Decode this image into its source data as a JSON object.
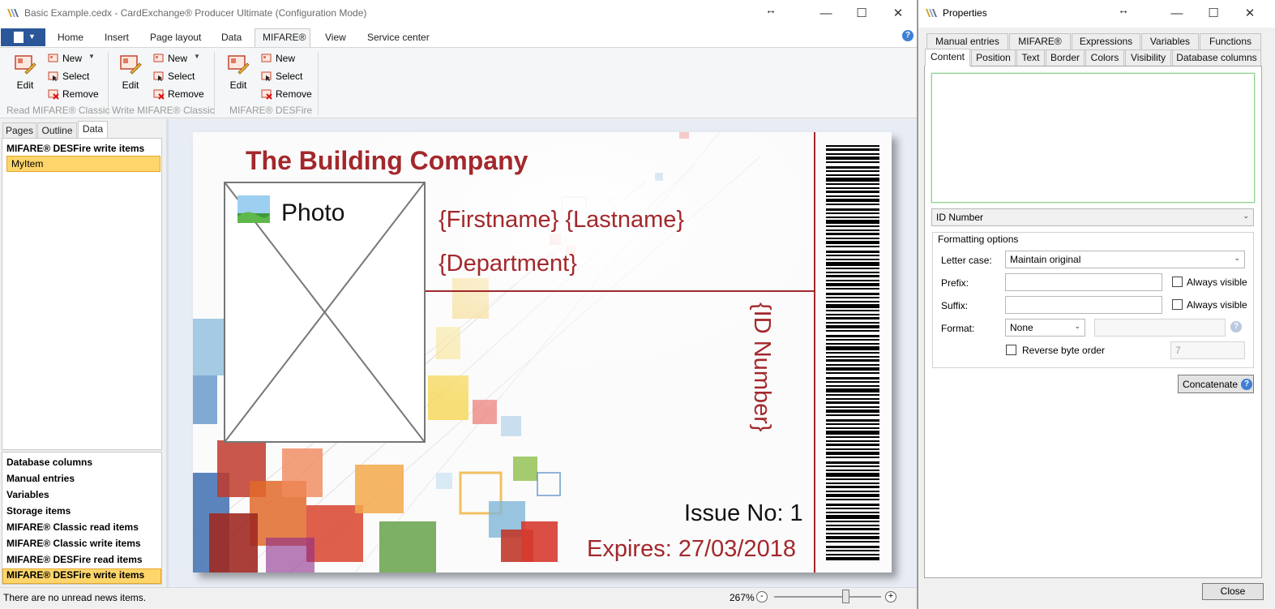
{
  "main_window": {
    "title": "Basic Example.cedx - CardExchange® Producer Ultimate (Configuration Mode)",
    "controls": {
      "minimize": "—",
      "maximize": "☐",
      "close": "✕",
      "resize": "↔"
    }
  },
  "ribbon": {
    "tabs": [
      "Home",
      "Insert",
      "Page layout",
      "Data",
      "MIFARE®",
      "View",
      "Service center"
    ],
    "active_tab": "MIFARE®",
    "help": "?",
    "groups": [
      {
        "label": "Read MIFARE® Classic",
        "edit": "Edit",
        "new": "New",
        "select": "Select",
        "remove": "Remove"
      },
      {
        "label": "Write MIFARE® Classic",
        "edit": "Edit",
        "new": "New",
        "select": "Select",
        "remove": "Remove"
      },
      {
        "label": "MIFARE® DESFire",
        "edit": "Edit",
        "new": "New",
        "select": "Select",
        "remove": "Remove"
      }
    ]
  },
  "left_panel": {
    "tabs": [
      "Pages",
      "Outline",
      "Data"
    ],
    "active_tab": "Data",
    "section_title": "MIFARE® DESFire write items",
    "selected_item": "MyItem",
    "categories": [
      "Database columns",
      "Manual entries",
      "Variables",
      "Storage items",
      "MIFARE® Classic read items",
      "MIFARE® Classic write items",
      "MIFARE® DESFire read items",
      "MIFARE® DESFire write items"
    ],
    "selected_category": "MIFARE® DESFire write items"
  },
  "card": {
    "company": "The Building Company",
    "name": "{Firstname} {Lastname}",
    "department": "{Department}",
    "id_number": "{ID Number}",
    "photo_label": "Photo",
    "issue": "Issue No: 1",
    "expires": "Expires: 27/03/2018",
    "accent_color": "#a3282c"
  },
  "status_bar": {
    "text": "There are no unread news items.",
    "zoom": "267%",
    "zoom_out": "-",
    "zoom_in": "+",
    "zoom_fraction": 0.67
  },
  "properties": {
    "title": "Properties",
    "controls": {
      "minimize": "—",
      "maximize": "☐",
      "close": "✕",
      "resize": "↔"
    },
    "tabs_row1": [
      "Manual entries",
      "MIFARE®",
      "Expressions",
      "Variables",
      "Functions"
    ],
    "tabs_row2": [
      "Content",
      "Position",
      "Text",
      "Border",
      "Colors",
      "Visibility",
      "Database columns"
    ],
    "active_tab": "Content",
    "content_value": "",
    "field_select": "ID Number",
    "formatting": {
      "title": "Formatting options",
      "letter_case_label": "Letter case:",
      "letter_case_value": "Maintain original",
      "prefix_label": "Prefix:",
      "prefix_value": "",
      "suffix_label": "Suffix:",
      "suffix_value": "",
      "always_visible": "Always visible",
      "format_label": "Format:",
      "format_value": "None",
      "format_extra": "",
      "help": "?",
      "reverse_byte_order": "Reverse byte order",
      "byte_value": "7"
    },
    "concatenate": "Concatenate",
    "close": "Close"
  }
}
